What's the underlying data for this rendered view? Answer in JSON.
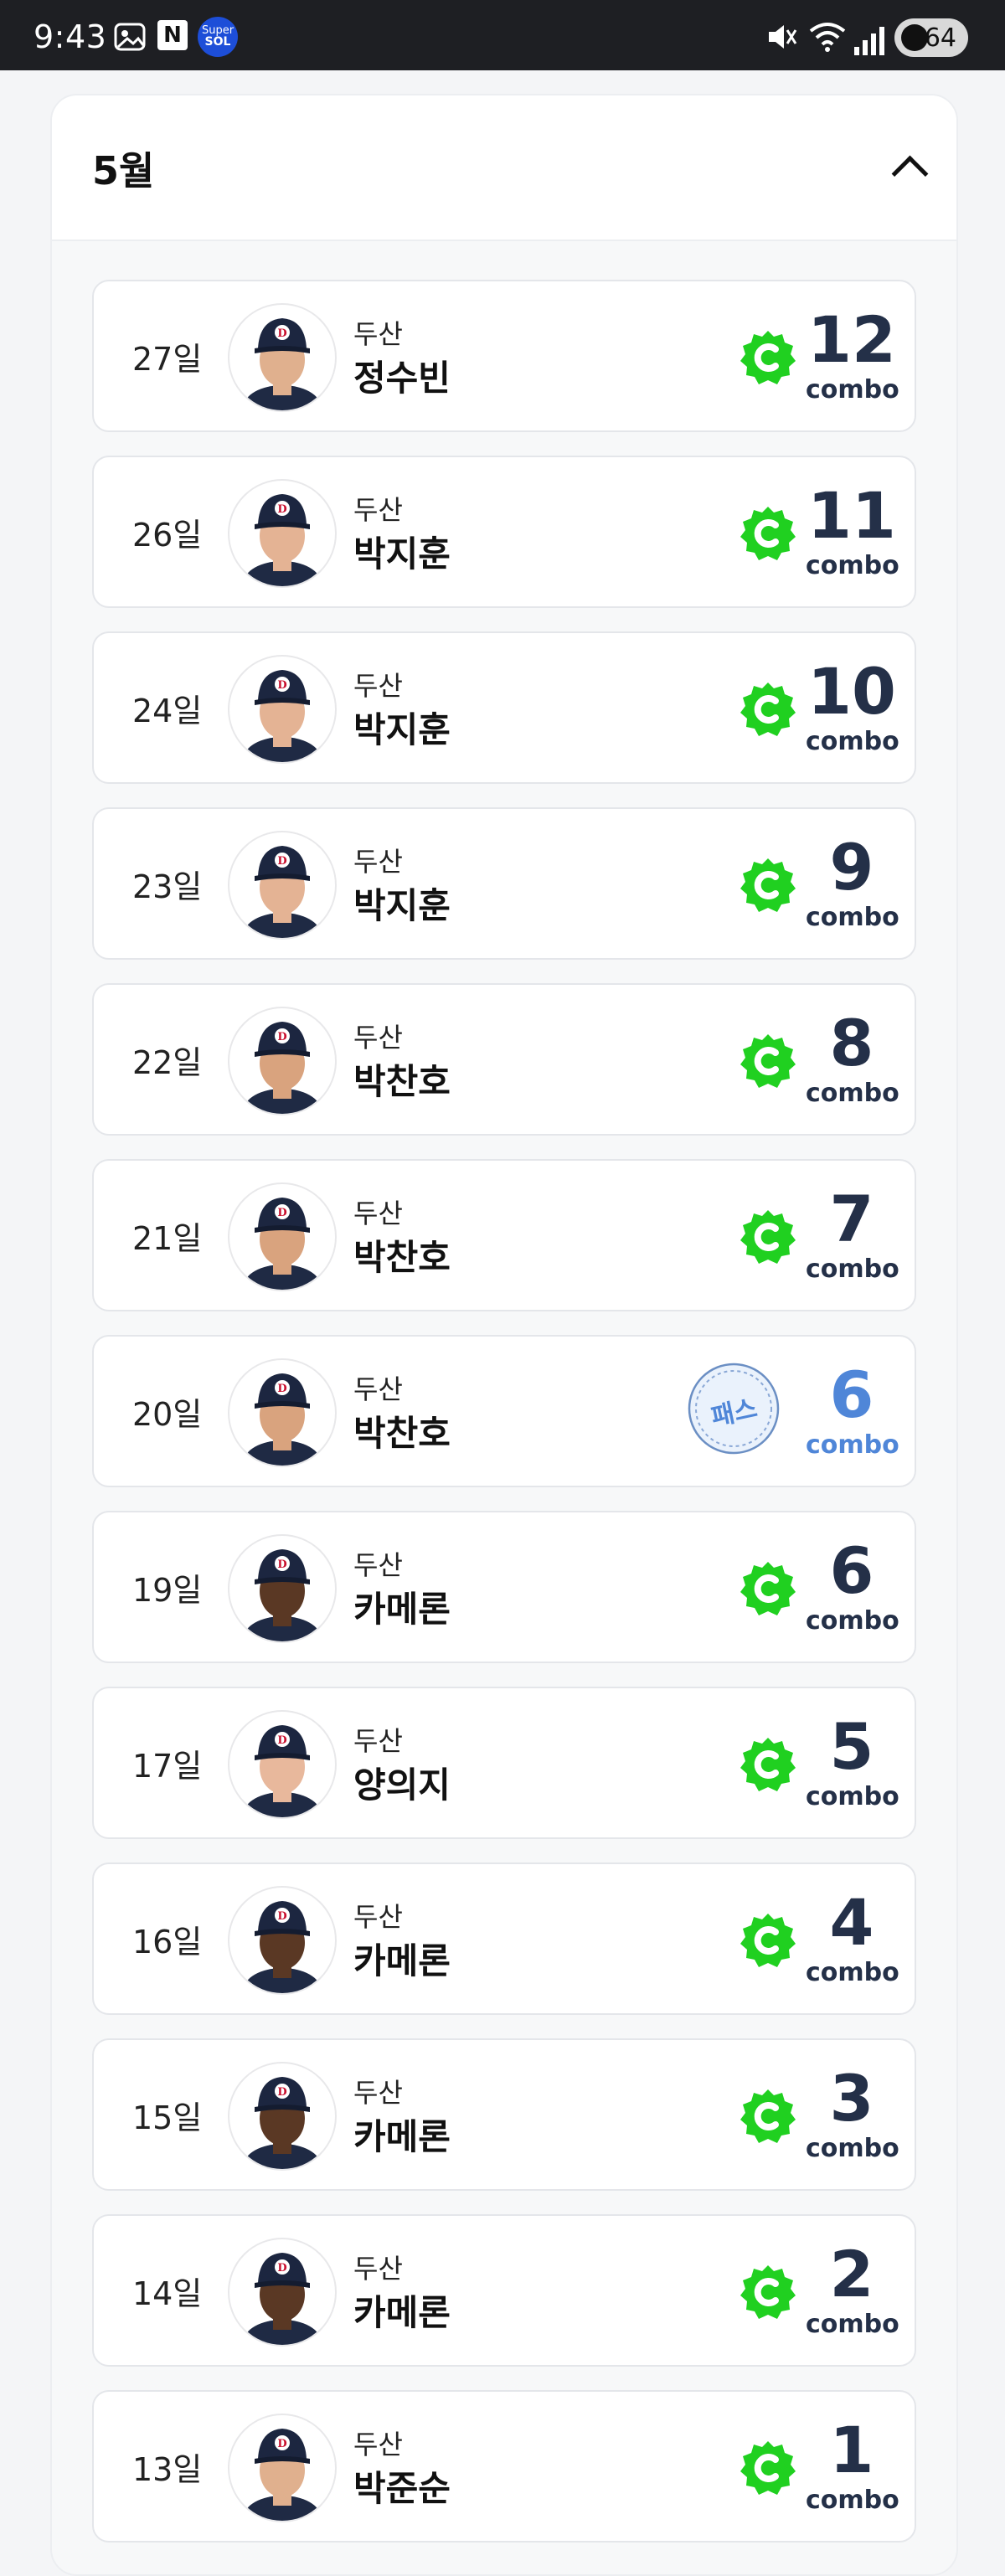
{
  "status_bar": {
    "time": "9:43",
    "n_label": "N",
    "sol_label_1": "Super",
    "sol_label_2": "SOL",
    "battery": "64"
  },
  "section": {
    "title": "5월",
    "expanded": true
  },
  "colors": {
    "combo_green": "#20d020",
    "pass_blue": "#4f86d8",
    "combo_text": "#243048"
  },
  "entries": [
    {
      "day": "27일",
      "team": "두산",
      "player": "정수빈",
      "badge": "combo-badge",
      "combo": "12",
      "combo_label": "combo",
      "skin": "#e0b08e"
    },
    {
      "day": "26일",
      "team": "두산",
      "player": "박지훈",
      "badge": "combo-badge",
      "combo": "11",
      "combo_label": "combo",
      "skin": "#e4b394"
    },
    {
      "day": "24일",
      "team": "두산",
      "player": "박지훈",
      "badge": "combo-badge",
      "combo": "10",
      "combo_label": "combo",
      "skin": "#e4b394"
    },
    {
      "day": "23일",
      "team": "두산",
      "player": "박지훈",
      "badge": "combo-badge",
      "combo": "9",
      "combo_label": "combo",
      "skin": "#e4b394"
    },
    {
      "day": "22일",
      "team": "두산",
      "player": "박찬호",
      "badge": "combo-badge",
      "combo": "8",
      "combo_label": "combo",
      "skin": "#d9a37e"
    },
    {
      "day": "21일",
      "team": "두산",
      "player": "박찬호",
      "badge": "combo-badge",
      "combo": "7",
      "combo_label": "combo",
      "skin": "#d9a37e"
    },
    {
      "day": "20일",
      "team": "두산",
      "player": "박찬호",
      "badge": "pass-badge",
      "pass_label": "패스",
      "combo": "6",
      "combo_label": "combo",
      "skin": "#d9a37e"
    },
    {
      "day": "19일",
      "team": "두산",
      "player": "카메론",
      "badge": "combo-badge",
      "combo": "6",
      "combo_label": "combo",
      "skin": "#5a3824"
    },
    {
      "day": "17일",
      "team": "두산",
      "player": "양의지",
      "badge": "combo-badge",
      "combo": "5",
      "combo_label": "combo",
      "skin": "#e8b89c"
    },
    {
      "day": "16일",
      "team": "두산",
      "player": "카메론",
      "badge": "combo-badge",
      "combo": "4",
      "combo_label": "combo",
      "skin": "#5a3824"
    },
    {
      "day": "15일",
      "team": "두산",
      "player": "카메론",
      "badge": "combo-badge",
      "combo": "3",
      "combo_label": "combo",
      "skin": "#5a3824"
    },
    {
      "day": "14일",
      "team": "두산",
      "player": "카메론",
      "badge": "combo-badge",
      "combo": "2",
      "combo_label": "combo",
      "skin": "#5a3824"
    },
    {
      "day": "13일",
      "team": "두산",
      "player": "박준순",
      "badge": "combo-badge",
      "combo": "1",
      "combo_label": "combo",
      "skin": "#e0b08e"
    }
  ]
}
